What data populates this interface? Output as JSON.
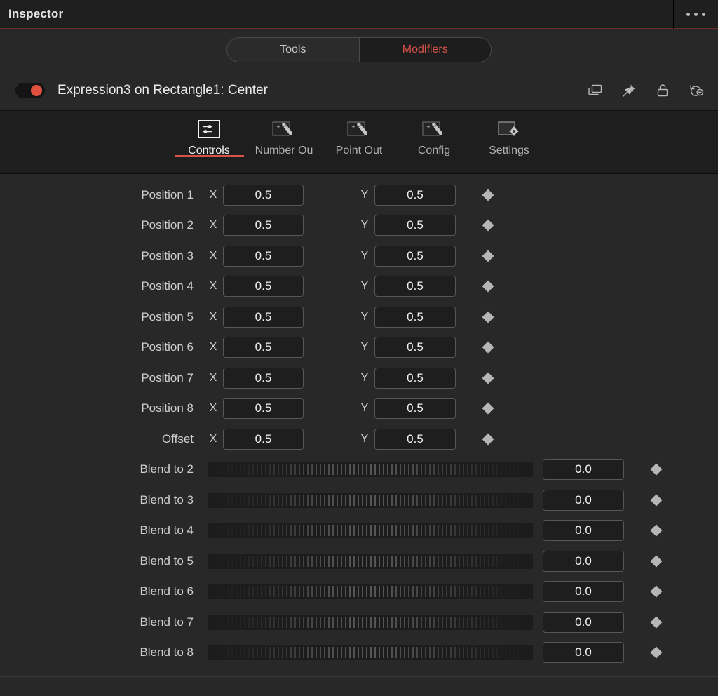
{
  "titlebar": {
    "title": "Inspector",
    "overflow_label": "overflow-menu",
    "accent_color": "#6d2f28"
  },
  "segmented": {
    "items": [
      {
        "label": "Tools",
        "active": false
      },
      {
        "label": "Modifiers",
        "active": true
      }
    ],
    "active_color": "#d9524a"
  },
  "modifier_header": {
    "enabled": true,
    "toggle_color": "#e0503f",
    "title": "Expression3 on Rectangle1: Center",
    "icons": [
      {
        "name": "duplicate-icon",
        "label": "Duplicate"
      },
      {
        "name": "pin-icon",
        "label": "Pin"
      },
      {
        "name": "lock-icon",
        "label": "Lock"
      },
      {
        "name": "reset-icon",
        "label": "Reset"
      }
    ]
  },
  "tool_tabs": [
    {
      "label": "Controls",
      "icon": "sliders-icon",
      "active": true
    },
    {
      "label": "Number Ou",
      "icon": "magic-wand-icon",
      "active": false
    },
    {
      "label": "Point Out",
      "icon": "magic-wand-icon",
      "active": false
    },
    {
      "label": "Config",
      "icon": "magic-wand-icon",
      "active": false
    },
    {
      "label": "Settings",
      "icon": "gear-screen-icon",
      "active": false
    }
  ],
  "axis_labels": {
    "x": "X",
    "y": "Y"
  },
  "params": {
    "xy_rows": [
      {
        "label": "Position 1",
        "x": "0.5",
        "y": "0.5"
      },
      {
        "label": "Position 2",
        "x": "0.5",
        "y": "0.5"
      },
      {
        "label": "Position 3",
        "x": "0.5",
        "y": "0.5"
      },
      {
        "label": "Position 4",
        "x": "0.5",
        "y": "0.5"
      },
      {
        "label": "Position 5",
        "x": "0.5",
        "y": "0.5"
      },
      {
        "label": "Position 6",
        "x": "0.5",
        "y": "0.5"
      },
      {
        "label": "Position 7",
        "x": "0.5",
        "y": "0.5"
      },
      {
        "label": "Position 8",
        "x": "0.5",
        "y": "0.5"
      },
      {
        "label": "Offset",
        "x": "0.5",
        "y": "0.5"
      }
    ],
    "slider_rows": [
      {
        "label": "Blend to 2",
        "value": "0.0"
      },
      {
        "label": "Blend to 3",
        "value": "0.0"
      },
      {
        "label": "Blend to 4",
        "value": "0.0"
      },
      {
        "label": "Blend to 5",
        "value": "0.0"
      },
      {
        "label": "Blend to 6",
        "value": "0.0"
      },
      {
        "label": "Blend to 7",
        "value": "0.0"
      },
      {
        "label": "Blend to 8",
        "value": "0.0"
      }
    ]
  }
}
